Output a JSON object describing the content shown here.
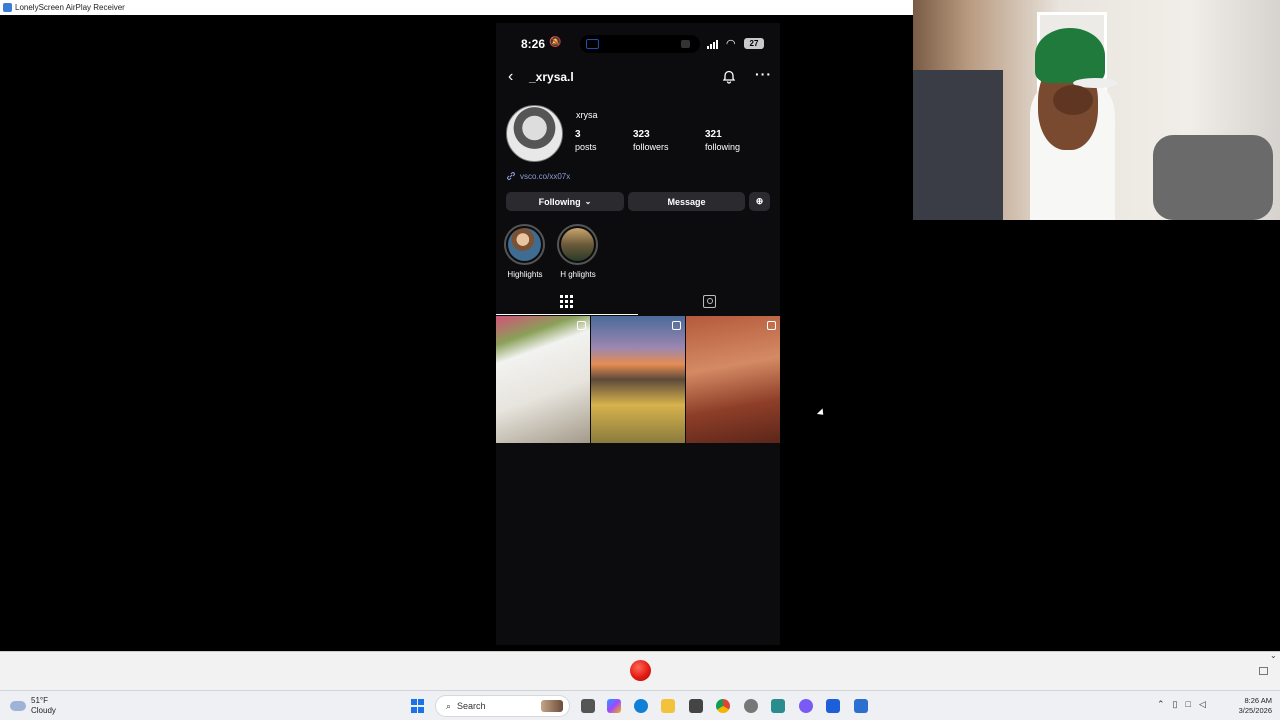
{
  "window": {
    "title": "LonelyScreen AirPlay Receiver"
  },
  "phone_status": {
    "time": "8:26",
    "battery": "27"
  },
  "profile": {
    "username": "_xrysa.l",
    "display_name": "xrysa",
    "posts_count": "3",
    "posts_label": "posts",
    "followers_count": "323",
    "followers_label": "followers",
    "following_count": "321",
    "following_label": "following",
    "link": "vsco.co/xx07x",
    "following_button": "Following",
    "message_button": "Message",
    "highlights": [
      {
        "label": "Highlights"
      },
      {
        "label": "H ghlights"
      }
    ]
  },
  "taskbar": {
    "weather_temp": "51°F",
    "weather_desc": "Cloudy",
    "search_label": "Search",
    "time": "8:26 AM",
    "date": "3/25/2026"
  },
  "icons": {
    "back": "chevron-left-icon",
    "bell": "bell-icon",
    "more": "more-icon",
    "grid": "grid-icon",
    "tagged": "tagged-icon",
    "record": "record-icon"
  },
  "colors": {
    "phone_bg": "#0c0c0e",
    "button_bg": "#2b2b2f",
    "link": "#8e9bd8",
    "record": "#e31b12"
  }
}
